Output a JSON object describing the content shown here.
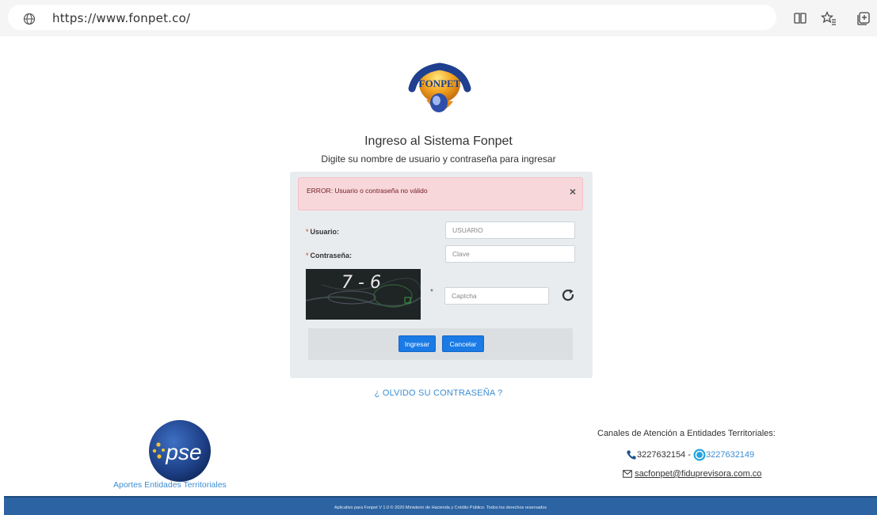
{
  "browser": {
    "url": "https://www.fonpet.co/",
    "icons": [
      "globe-icon",
      "reading-view-icon",
      "favorites-icon",
      "collections-icon"
    ]
  },
  "header": {
    "logo_text": "FONPET",
    "title": "Ingreso al Sistema Fonpet",
    "subtitle": "Digite su nombre de usuario y contraseña para ingresar"
  },
  "alert": {
    "message": "ERROR: Usuario o contraseña no válido",
    "close": "×"
  },
  "form": {
    "required_mark": "*",
    "user_label": "Usuario:",
    "user_placeholder": "USUARIO",
    "password_label": "Contraseña:",
    "password_placeholder": "Clave",
    "captcha_text": "7 - 6",
    "captcha_placeholder": "Captcha",
    "submit_label": "Ingresar",
    "cancel_label": "Cancelar"
  },
  "forgot_password": "¿ OLVIDO SU CONTRASEÑA ?",
  "pse": {
    "logo_text": "pse",
    "caption": "Aportes Entidades Territoriales"
  },
  "contact": {
    "title": "Canales de Atención a Entidades Territoriales:",
    "phone": "3227632154",
    "separator": "-",
    "whatsapp": "3227632149",
    "email": "sacfonpet@fiduprevisora.com.co"
  },
  "footer": {
    "text": "Aplicativo para Fonpet V 1.0 © 2020 Ministerio de Hacienda y Crédito Público. Todos los derechos reservados"
  },
  "colors": {
    "primary_button": "#1a7ae6",
    "link": "#3c8dd3",
    "alert_bg": "#f8d7da",
    "alert_text": "#721c24",
    "footer_bg": "#2c63a2",
    "whatsapp": "#25a4e0"
  }
}
